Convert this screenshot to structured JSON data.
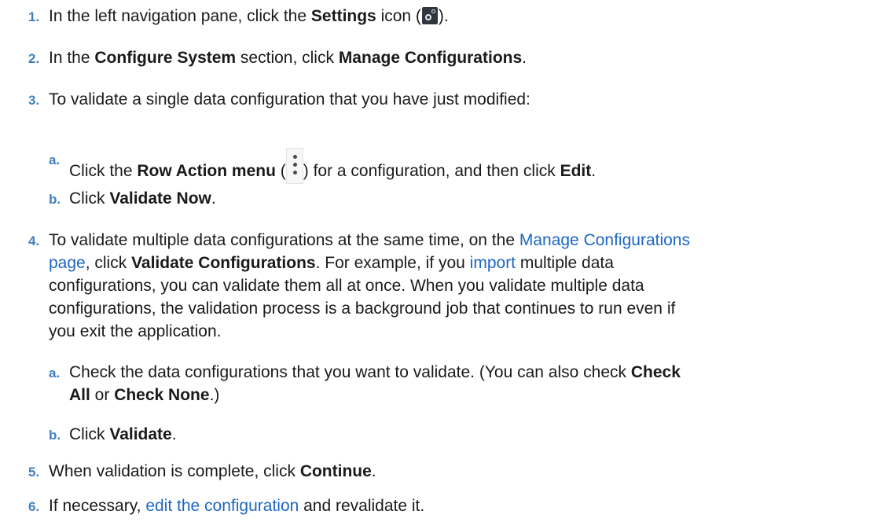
{
  "steps": {
    "s1": {
      "num": "1.",
      "t1": "In the left navigation pane, click the ",
      "b1": "Settings",
      "t2": " icon (",
      "icon": "gear-icon",
      "t3": ")."
    },
    "s2": {
      "num": "2.",
      "t1": "In the ",
      "b1": "Configure System",
      "t2": " section, click ",
      "b2": "Manage Configurations",
      "t3": "."
    },
    "s3": {
      "num": "3.",
      "t1": "To validate a single data configuration that you have just modified:",
      "a": {
        "num": "a.",
        "t1": "Click the ",
        "b1": "Row Action menu",
        "t2": " (",
        "icon": "kebab-icon",
        "t3": ") for a configuration, and then click ",
        "b2": "Edit",
        "t4": "."
      },
      "b": {
        "num": "b.",
        "t1": "Click ",
        "b1": "Validate Now",
        "t2": "."
      }
    },
    "s4": {
      "num": "4.",
      "l1_t1": "To validate multiple data configurations at the same time, on the ",
      "l1_link": "Manage Configurations",
      "l2_link": "page",
      "l2_t1": ", click ",
      "l2_b1": "Validate Configurations",
      "l2_t2": ". For example, if you ",
      "l2_link2": "import",
      "l2_t3": " multiple data",
      "l3": "configurations, you can validate them all at once. When you validate multiple data",
      "l4": "configurations, the validation process is a background job that continues to run even if",
      "l5": "you exit the application.",
      "a": {
        "num": "a.",
        "l1_t1": "Check the data configurations that you want to validate. (You can also check ",
        "l1_b1": "Check",
        "l2_b1": "All",
        "l2_t1": " or ",
        "l2_b2": "Check None",
        "l2_t2": ".)"
      },
      "b": {
        "num": "b.",
        "t1": "Click ",
        "b1": "Validate",
        "t2": "."
      }
    },
    "s5": {
      "num": "5.",
      "t1": "When validation is complete, click ",
      "b1": "Continue",
      "t2": "."
    },
    "s6": {
      "num": "6.",
      "t1": "If necessary, ",
      "link": "edit the configuration",
      "t2": " and revalidate it."
    }
  }
}
